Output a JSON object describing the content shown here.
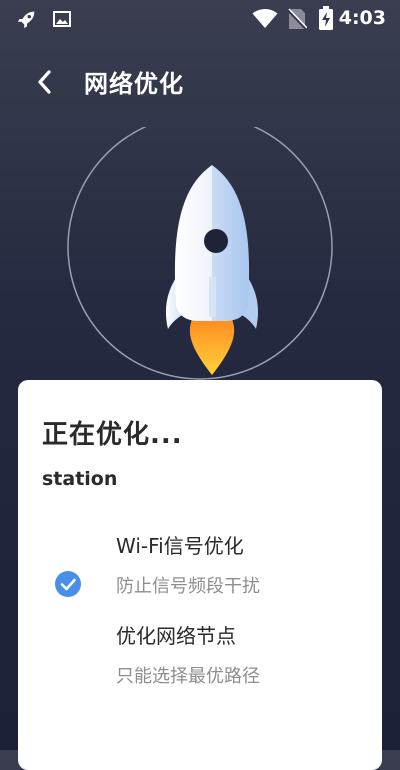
{
  "status_bar": {
    "time": "4:03",
    "icons": [
      "rocket-icon",
      "image-icon",
      "wifi-icon",
      "no-sim-icon",
      "battery-charging-icon"
    ]
  },
  "header": {
    "title": "网络优化",
    "back_icon": "chevron-left-icon"
  },
  "hero": {
    "icon": "rocket-icon"
  },
  "card": {
    "title": "正在优化...",
    "network_name": "station",
    "tasks": [
      {
        "title": "Wi-Fi信号优化",
        "description": "防止信号频段干扰",
        "status": "done"
      },
      {
        "title": "优化网络节点",
        "description": "只能选择最优路径",
        "status": "pending"
      }
    ]
  },
  "colors": {
    "background_top": "#3a3e50",
    "background_bottom": "#1c2038",
    "card_background": "#ffffff",
    "check_blue": "#4a8fe7",
    "flame_orange": "#f5a623",
    "secondary_text": "#8e8e8e"
  }
}
